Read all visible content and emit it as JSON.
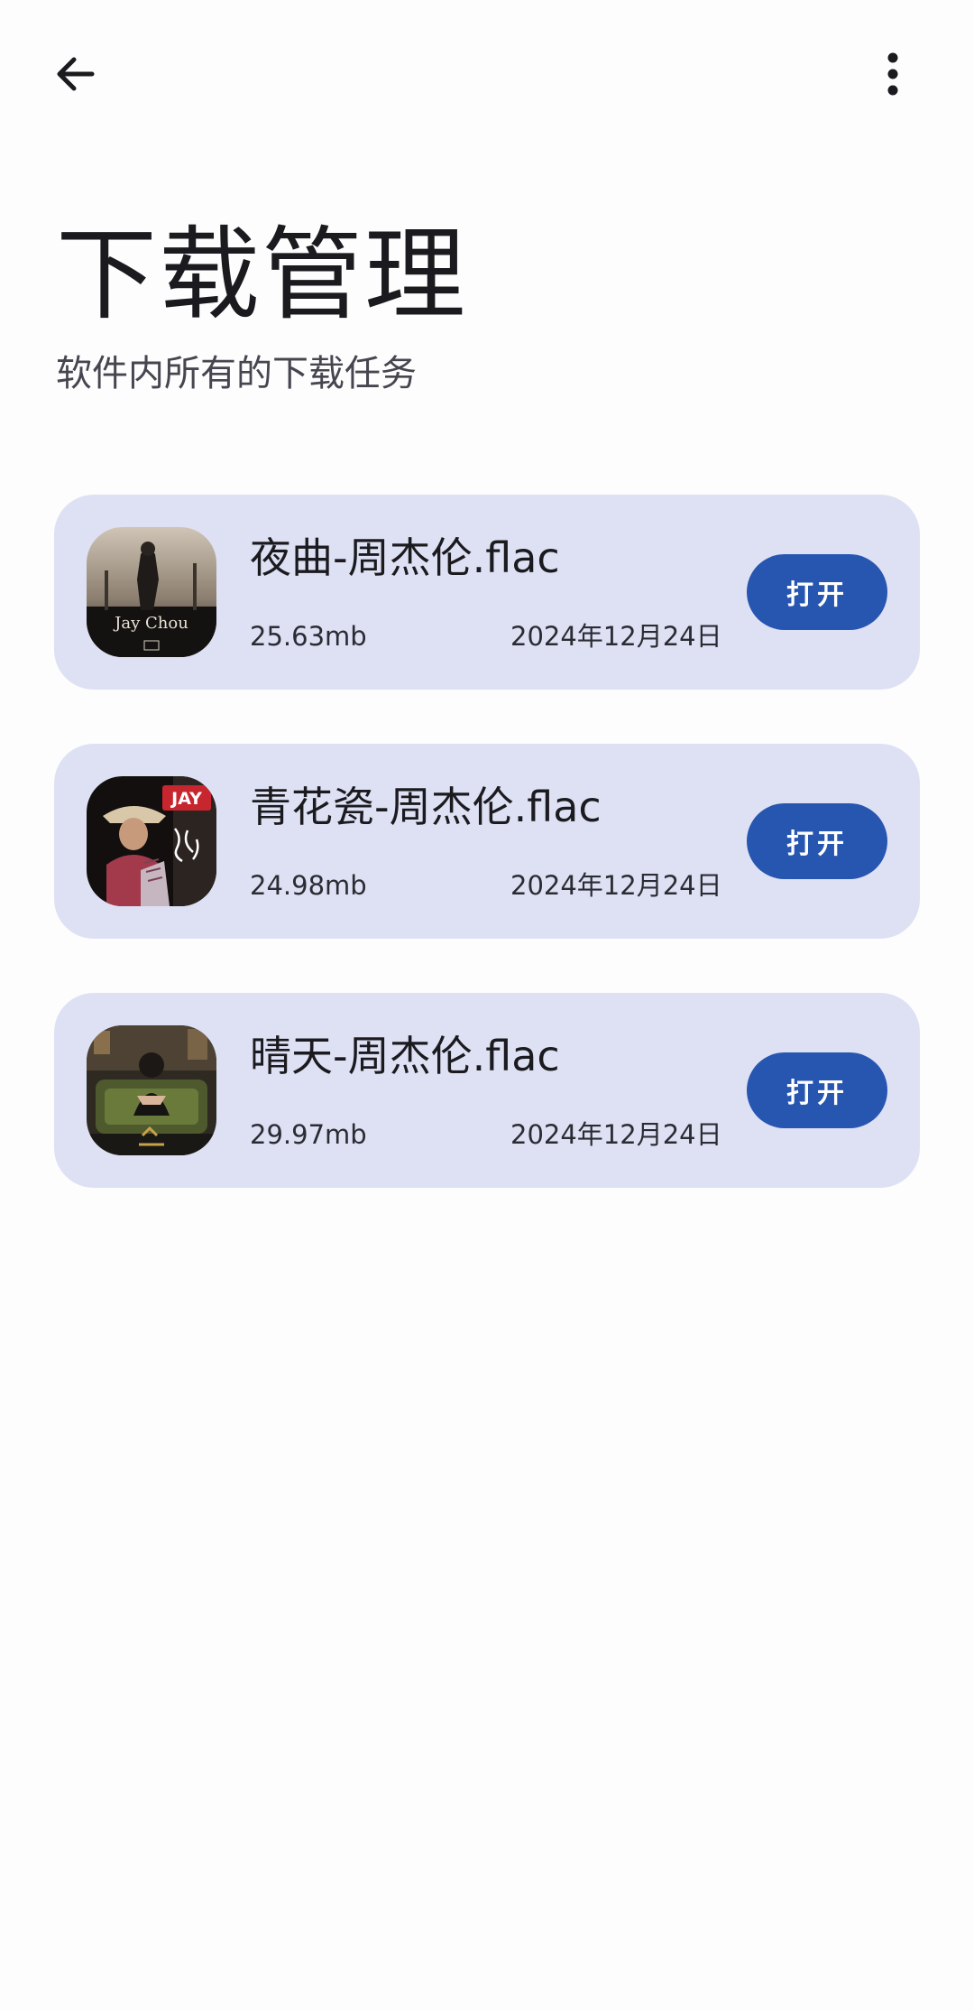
{
  "header": {
    "back_icon": "arrow-back-icon",
    "more_icon": "more-vert-icon"
  },
  "page": {
    "title": "下载管理",
    "subtitle": "软件内所有的下载任务"
  },
  "downloads": [
    {
      "name": "夜曲-周杰伦.flac",
      "size": "25.63mb",
      "date": "2024年12月24日",
      "action": "打开",
      "cover_caption": "Jay Chou"
    },
    {
      "name": "青花瓷-周杰伦.flac",
      "size": "24.98mb",
      "date": "2024年12月24日",
      "action": "打开",
      "cover_caption": "JAY"
    },
    {
      "name": "晴天-周杰伦.flac",
      "size": "29.97mb",
      "date": "2024年12月24日",
      "action": "打开"
    }
  ],
  "colors": {
    "background": "#fdfdfe",
    "card": "#dee1f4",
    "button": "#2756b0",
    "button_text": "#ffffff",
    "title_text": "#1b1b1f",
    "subtitle_text": "#45464f"
  }
}
